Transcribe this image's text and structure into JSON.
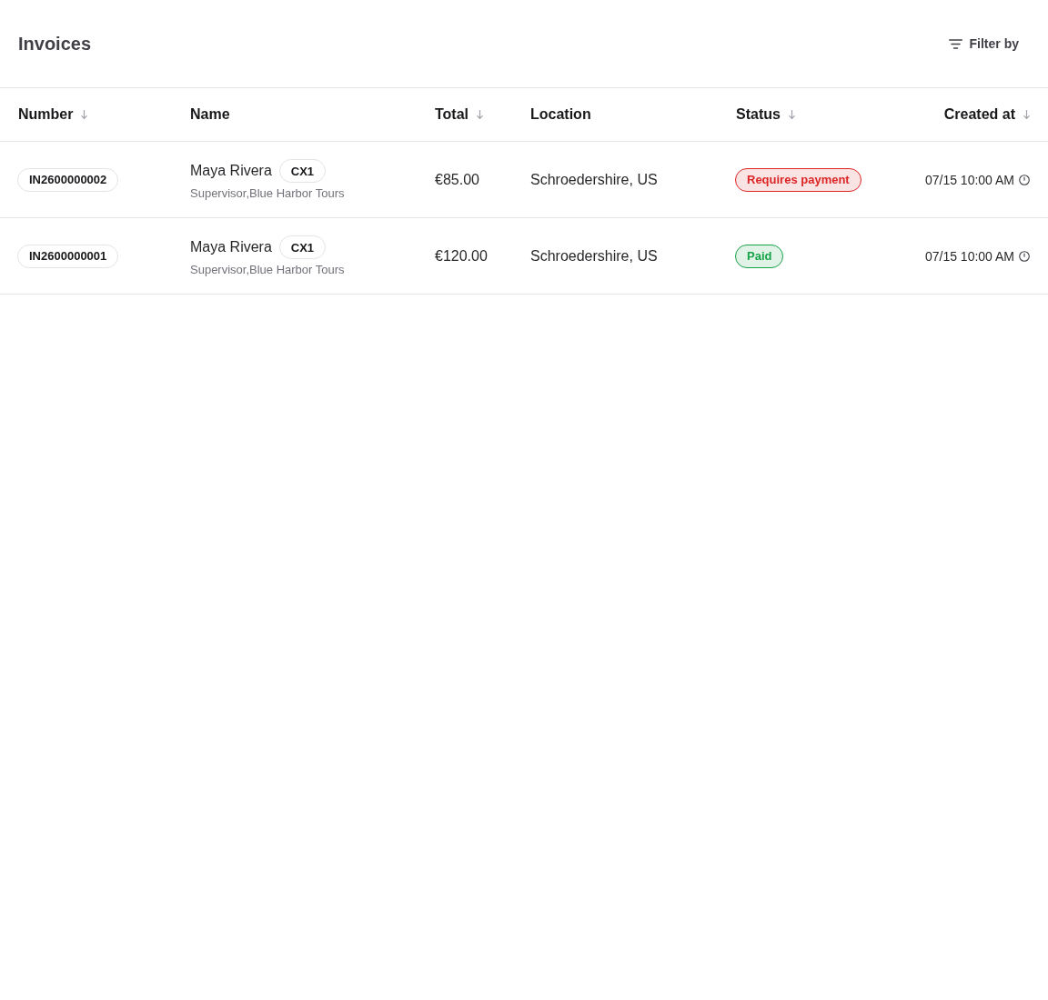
{
  "header": {
    "title": "Invoices",
    "filter_button": {
      "label": "Filter by"
    }
  },
  "table": {
    "columns": [
      {
        "label": "Number",
        "sortable": true
      },
      {
        "label": "Name",
        "sortable": false
      },
      {
        "label": "Total",
        "sortable": true
      },
      {
        "label": "Location",
        "sortable": false
      },
      {
        "label": "Status",
        "sortable": true
      },
      {
        "label": "Created at",
        "sortable": true
      }
    ],
    "rows": [
      {
        "number": "IN2600000002",
        "name": "Maya Rivera",
        "tag": "CX1",
        "subtitle": "Supervisor,Blue Harbor Tours",
        "total": "€85.00",
        "location": "Schroedershire, US",
        "status": {
          "label": "Requires payment",
          "color": "#dc2626"
        },
        "created_at": "07/15 10:00 AM"
      },
      {
        "number": "IN2600000001",
        "name": "Maya Rivera",
        "tag": "CX1",
        "subtitle": "Supervisor,Blue Harbor Tours",
        "total": "€120.00",
        "location": "Schroedershire, US",
        "status": {
          "label": "Paid",
          "color": "#16a34a"
        },
        "created_at": "07/15 10:00 AM"
      }
    ]
  }
}
